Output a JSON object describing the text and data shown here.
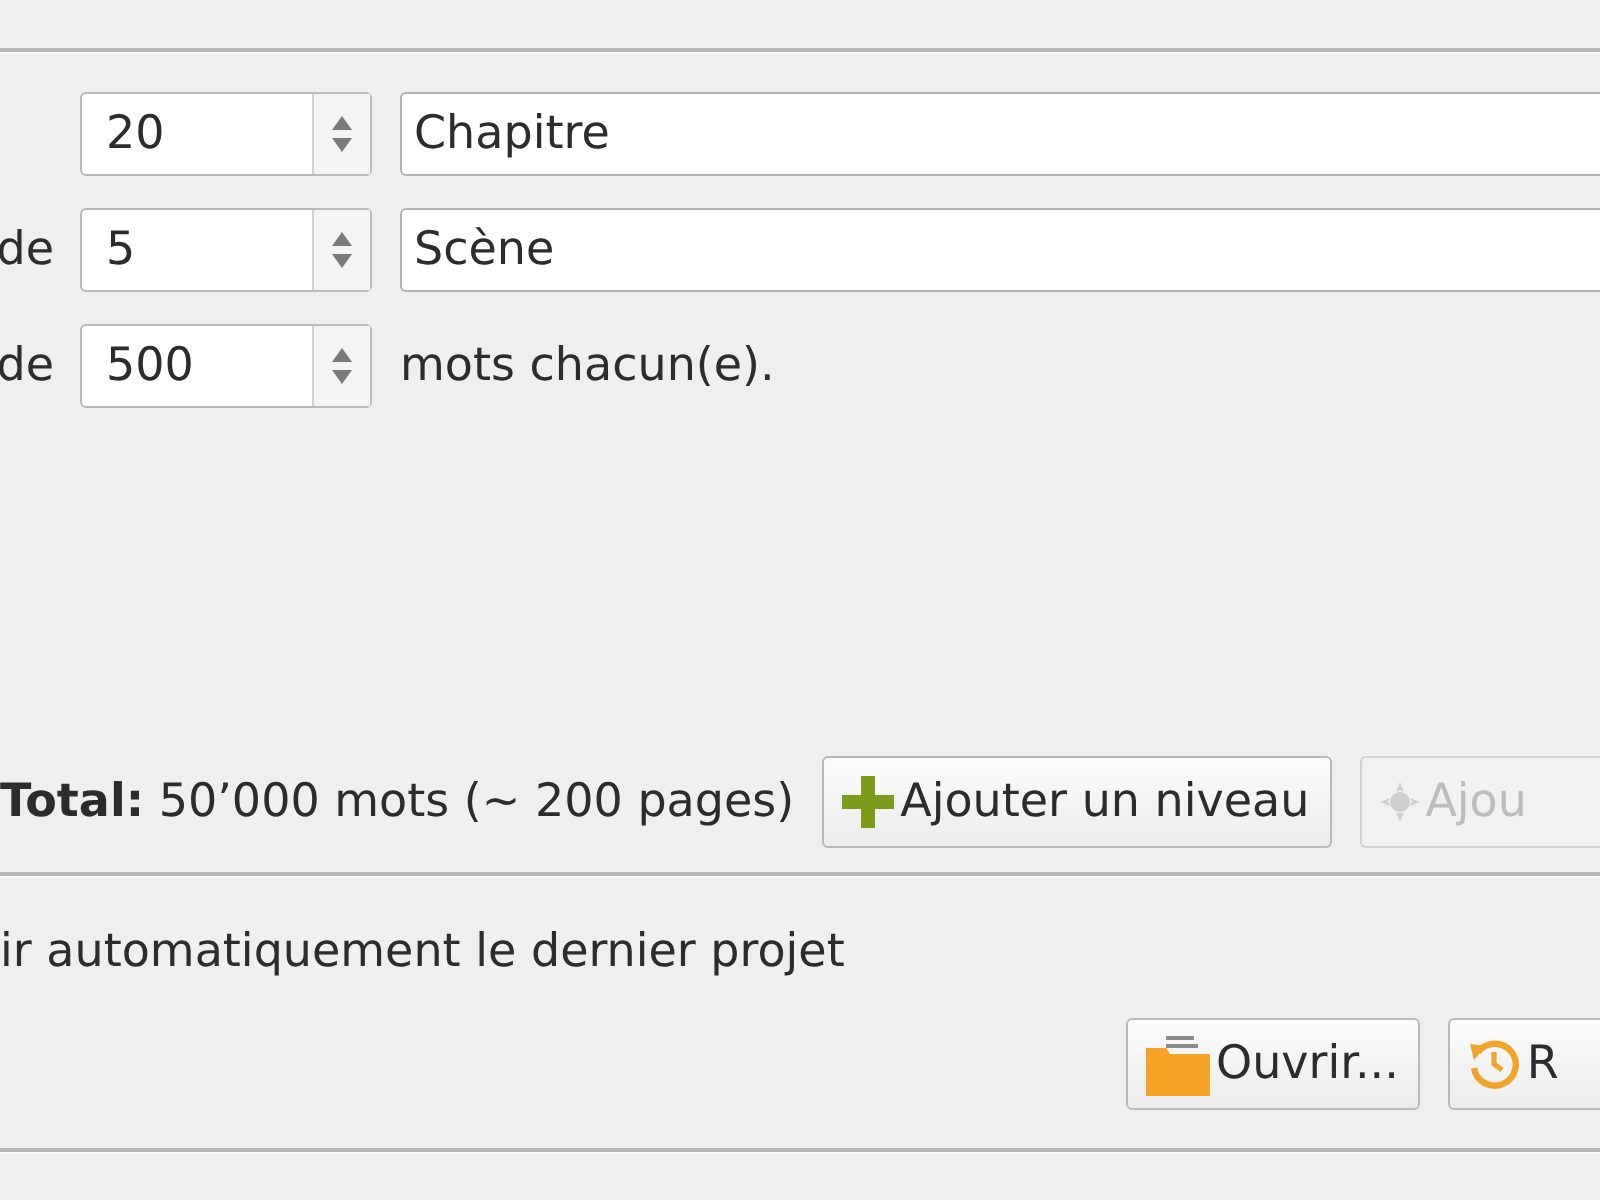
{
  "levels": [
    {
      "count": "20",
      "kind": "named",
      "name": "Chapitre"
    },
    {
      "label": "de",
      "count": "5",
      "kind": "named",
      "name": "Scène"
    },
    {
      "label": "de",
      "count": "500",
      "kind": "words",
      "suffix": "mots chacun(e)."
    }
  ],
  "total_row": {
    "text": "**Total:** 50’000 mots (~ 200 pages)",
    "buttons": [
      {
        "label": "Ajouter un niveau",
        "disabled": false
      },
      {
        "label": "Ajou",
        "disabled": true
      }
    ]
  },
  "footer": {
    "checkbox_label": "ir automatiquement le dernier projet",
    "buttons": [
      {
        "label": "Ouvrir..."
      },
      {
        "label": "R"
      }
    ]
  }
}
